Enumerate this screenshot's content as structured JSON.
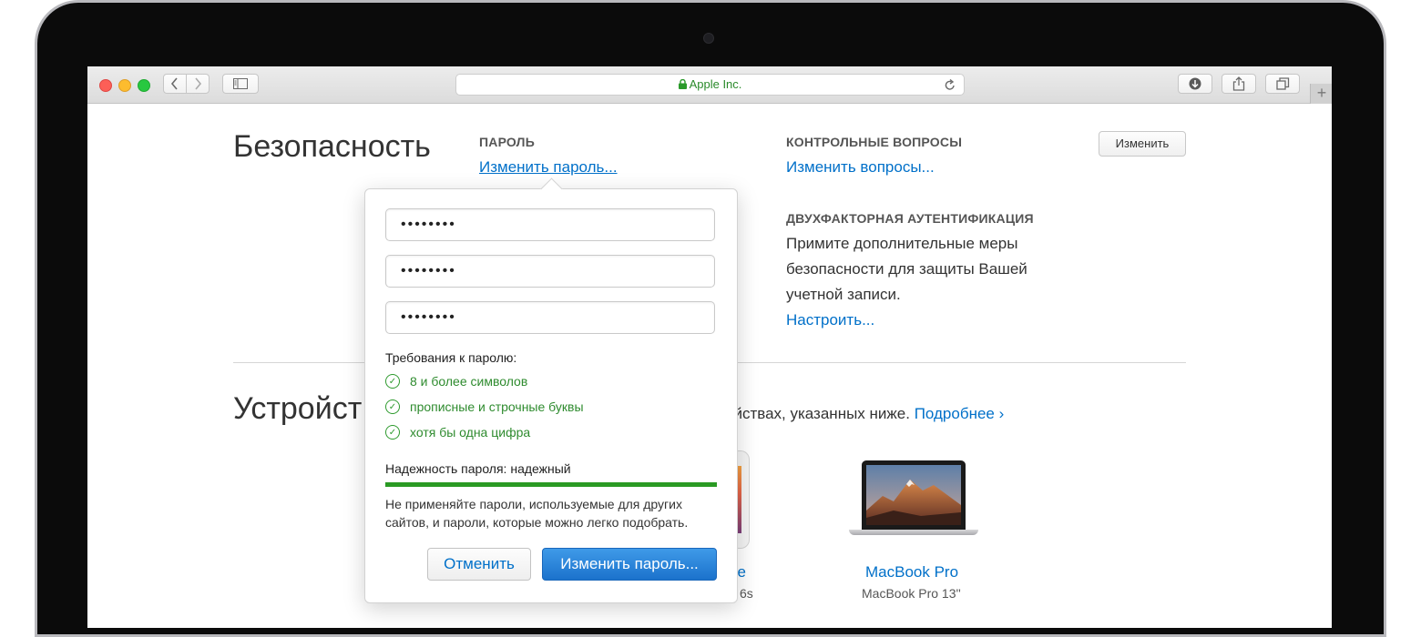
{
  "browser": {
    "url_text": "Apple Inc.",
    "icons": {
      "back": "chevron-left-icon",
      "forward": "chevron-right-icon",
      "sidebar": "sidebar-icon",
      "lock": "lock-icon",
      "reload": "reload-icon",
      "download": "download-icon",
      "share": "share-icon",
      "tabs": "tabs-icon",
      "new_tab": "plus-icon"
    },
    "new_tab_glyph": "+"
  },
  "security": {
    "title": "Безопасность",
    "password_label": "ПАРОЛЬ",
    "change_password_link": "Изменить пароль...",
    "questions_label": "КОНТРОЛЬНЫЕ ВОПРОСЫ",
    "change_questions_link": "Изменить вопросы...",
    "edit_button": "Изменить",
    "twofa_label": "ДВУХФАКТОРНАЯ АУТЕНТИФИКАЦИЯ",
    "twofa_text_1": "Примите дополнительные меры",
    "twofa_text_2": "безопасности для защиты Вашей",
    "twofa_text_3": "учетной записи.",
    "setup_link": "Настроить..."
  },
  "devices": {
    "title_visible": "Устройст",
    "desc_visible": "ойствах, указанных ниже.",
    "more_link": "Подробнее",
    "more_chevron": "›",
    "iphone_name_visible": "ne",
    "iphone_model_visible": "6s",
    "mac_name": "MacBook Pro",
    "mac_model": "MacBook Pro 13''"
  },
  "popover": {
    "fields": [
      "••••••••",
      "••••••••",
      "••••••••"
    ],
    "requirements_title": "Требования к паролю:",
    "requirements": [
      "8 и более символов",
      "прописные и строчные буквы",
      "хотя бы одна цифра"
    ],
    "check_glyph": "✓",
    "strength_text": "Надежность пароля: надежный",
    "strength_fraction": 1.0,
    "warning": "Не применяйте пароли, используемые для других сайтов, и пароли, которые можно легко подобрать.",
    "cancel_button": "Отменить",
    "submit_button": "Изменить пароль..."
  },
  "colors": {
    "link": "#0070c9",
    "success": "#2e8b2e",
    "primary": "#1b72cc",
    "close": "#fc5f57",
    "minimize": "#fdbc2e",
    "zoom": "#28c840"
  }
}
